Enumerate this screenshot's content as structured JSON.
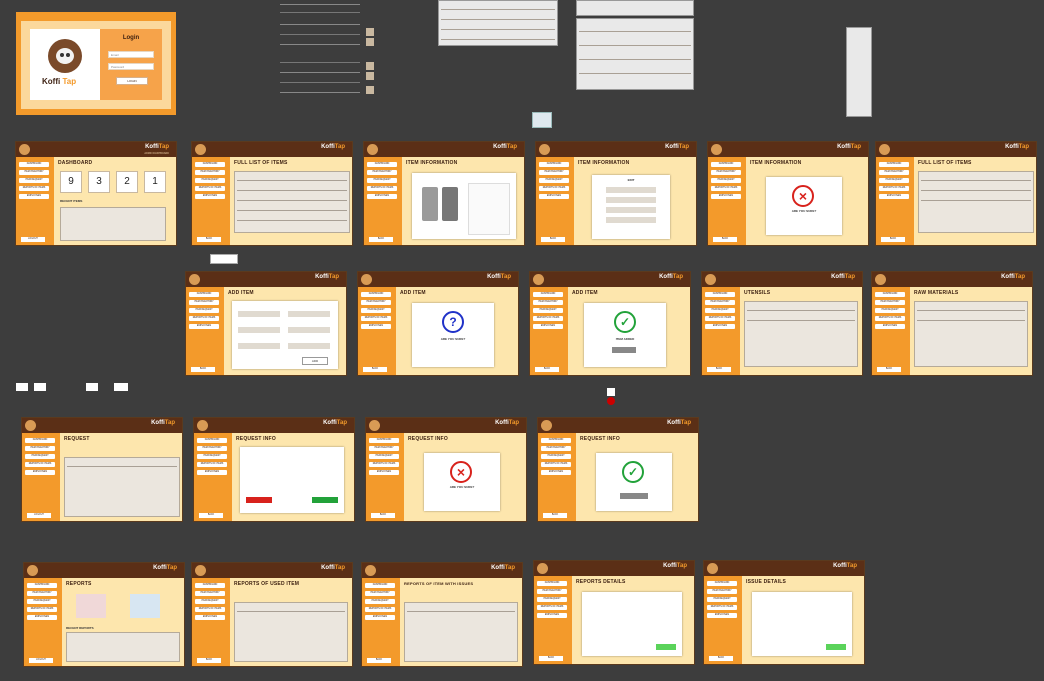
{
  "canvas_bg": "#3d3d3d",
  "brand": {
    "name_a": "Koffi",
    "name_b": "Tap",
    "tagline": "ADMIN DASHBOARD"
  },
  "colors": {
    "orange": "#f39a2b",
    "brown": "#5b2f16",
    "cream": "#fde6ad",
    "green": "#22a23a",
    "red": "#d8221c",
    "blue": "#2032c8"
  },
  "login": {
    "title": "Login",
    "username_placeholder": "Email",
    "password_placeholder": "Password",
    "button": "LOGIN",
    "logo_text_a": "Koffi",
    "logo_text_b": "Tap"
  },
  "nav": {
    "items": [
      "DASHBOARD",
      "ITEM INVENTORY",
      "ITEM REQUEST",
      "REPORTS OF ITEMS",
      "EMPLOYEES"
    ],
    "logout": "LOGOUT",
    "back": "BACK"
  },
  "frames": {
    "dashboard": {
      "title": "DASHBOARD",
      "stats": [
        "9",
        "3",
        "2",
        "1"
      ],
      "recent": "RECENT ITEMS"
    },
    "full_list": {
      "title": "FULL LIST OF ITEMS"
    },
    "item_info": {
      "title": "ITEM INFORMATION",
      "edit": "EDIT"
    },
    "add_item": {
      "title": "ADD ITEM",
      "add_btn": "ADD"
    },
    "utensils": {
      "title": "UTENSILS"
    },
    "raw_materials": {
      "title": "RAW MATERIALS"
    },
    "request": {
      "title": "REQUEST"
    },
    "request_info": {
      "title": "REQUEST INFO"
    },
    "reports": {
      "title": "REPORTS",
      "recent": "RECENT REPORTS"
    },
    "reports_used": {
      "title": "REPORTS OF USED ITEM"
    },
    "reports_issues": {
      "title": "REPORTS OF ITEM WITH ISSUES"
    },
    "reports_details": {
      "title": "REPORTS DETAILS"
    },
    "issue_details": {
      "title": "ISSUE DETAILS"
    }
  },
  "dialogs": {
    "are_you_sure": "ARE YOU SURE?",
    "item_added": "ITEM ADDED"
  }
}
